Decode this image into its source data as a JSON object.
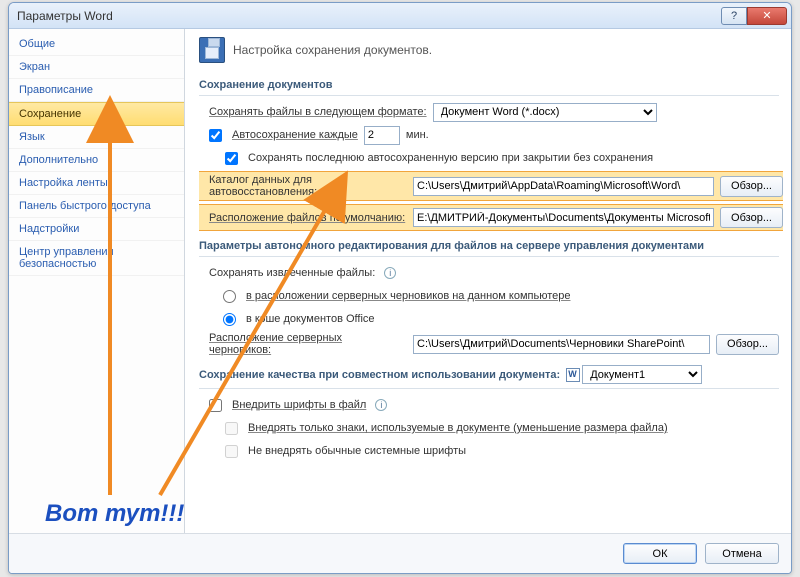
{
  "window": {
    "title": "Параметры Word"
  },
  "winbuttons": {
    "help": "?",
    "close": "✕"
  },
  "sidebar": {
    "items": [
      {
        "label": "Общие"
      },
      {
        "label": "Экран"
      },
      {
        "label": "Правописание"
      },
      {
        "label": "Сохранение"
      },
      {
        "label": "Язык"
      },
      {
        "label": "Дополнительно"
      },
      {
        "label": "Настройка ленты"
      },
      {
        "label": "Панель быстрого доступа"
      },
      {
        "label": "Надстройки"
      },
      {
        "label": "Центр управления безопасностью"
      }
    ],
    "selected_index": 3
  },
  "header": {
    "text": "Настройка сохранения документов."
  },
  "sections": {
    "save_docs": "Сохранение документов",
    "server": "Параметры автономного редактирования для файлов на сервере управления документами",
    "quality": "Сохранение качества при совместном использовании документа:"
  },
  "save": {
    "format_label": "Сохранять файлы в следующем формате:",
    "format_value": "Документ Word (*.docx)",
    "autosave_label": "Автосохранение каждые",
    "autosave_value": "2",
    "autosave_unit": "мин.",
    "keep_last_label": "Сохранять последнюю автосохраненную версию при закрытии без сохранения",
    "autorecover_label": "Каталог данных для автовосстановления:",
    "autorecover_path": "C:\\Users\\Дмитрий\\AppData\\Roaming\\Microsoft\\Word\\",
    "default_loc_label": "Расположение файлов по умолчанию:",
    "default_loc_path": "E:\\ДМИТРИЙ-Документы\\Documents\\Документы Microsoft Word",
    "browse": "Обзор..."
  },
  "server_opts": {
    "save_checked_label": "Сохранять извлеченные файлы:",
    "radio1": "в расположении серверных черновиков на данном компьютере",
    "radio2": "в кэше документов Office",
    "drafts_label": "Расположение серверных черновиков:",
    "drafts_path": "C:\\Users\\Дмитрий\\Documents\\Черновики SharePoint\\",
    "browse": "Обзор..."
  },
  "quality": {
    "doc_value": "Документ1",
    "embed_fonts": "Внедрить шрифты в файл",
    "embed_used_only": "Внедрять только знаки, используемые в документе (уменьшение размера файла)",
    "no_system_fonts": "Не внедрять обычные системные шрифты"
  },
  "footer": {
    "ok": "ОК",
    "cancel": "Отмена"
  },
  "annotation": {
    "text": "Вот тут!!!"
  }
}
